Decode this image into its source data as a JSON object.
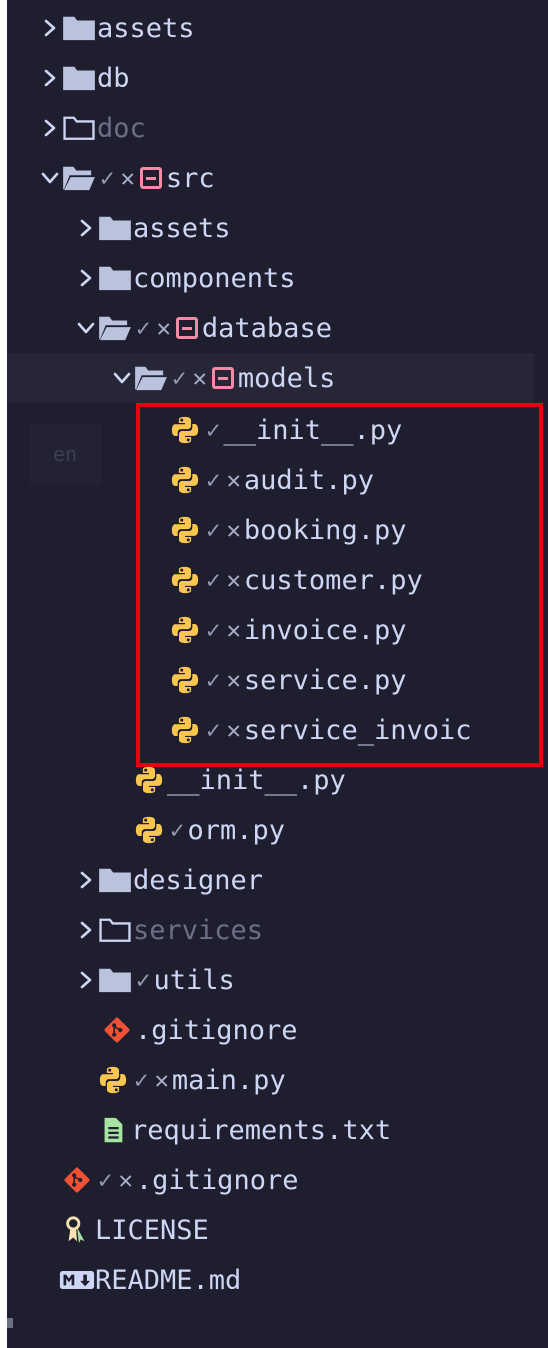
{
  "tree": {
    "root_items": [
      {
        "label": "assets"
      },
      {
        "label": "db"
      },
      {
        "label": "doc"
      },
      {
        "label": "src"
      }
    ],
    "src_children": {
      "assets": "assets",
      "components": "components",
      "database": "database",
      "models": "models",
      "models_files": [
        {
          "label": "__init__.py"
        },
        {
          "label": "audit.py"
        },
        {
          "label": "booking.py"
        },
        {
          "label": "customer.py"
        },
        {
          "label": "invoice.py"
        },
        {
          "label": "service.py"
        },
        {
          "label": "service_invoic"
        }
      ],
      "database_files": [
        {
          "label": "__init__.py"
        },
        {
          "label": "orm.py"
        }
      ],
      "designer": "designer",
      "services": "services",
      "utils": "utils",
      "gitignore": ".gitignore",
      "main": "main.py",
      "requirements": "requirements.txt"
    },
    "root_files": {
      "gitignore": ".gitignore",
      "license": "LICENSE",
      "readme": "README.md"
    }
  },
  "status_marks": {
    "check": "✓",
    "cross": "✕"
  },
  "overlay": {
    "language_badge": "en"
  },
  "colors": {
    "background": "#1e1e2e",
    "folder": "#bac2de",
    "python_blue": "#f9c74f",
    "python_yellow": "#f9c74f",
    "git": "#f05033",
    "conflict": "#f38ba8",
    "text_file": "#a6e3a1",
    "license": "#f9e2af",
    "highlight_border": "#e8000f"
  }
}
